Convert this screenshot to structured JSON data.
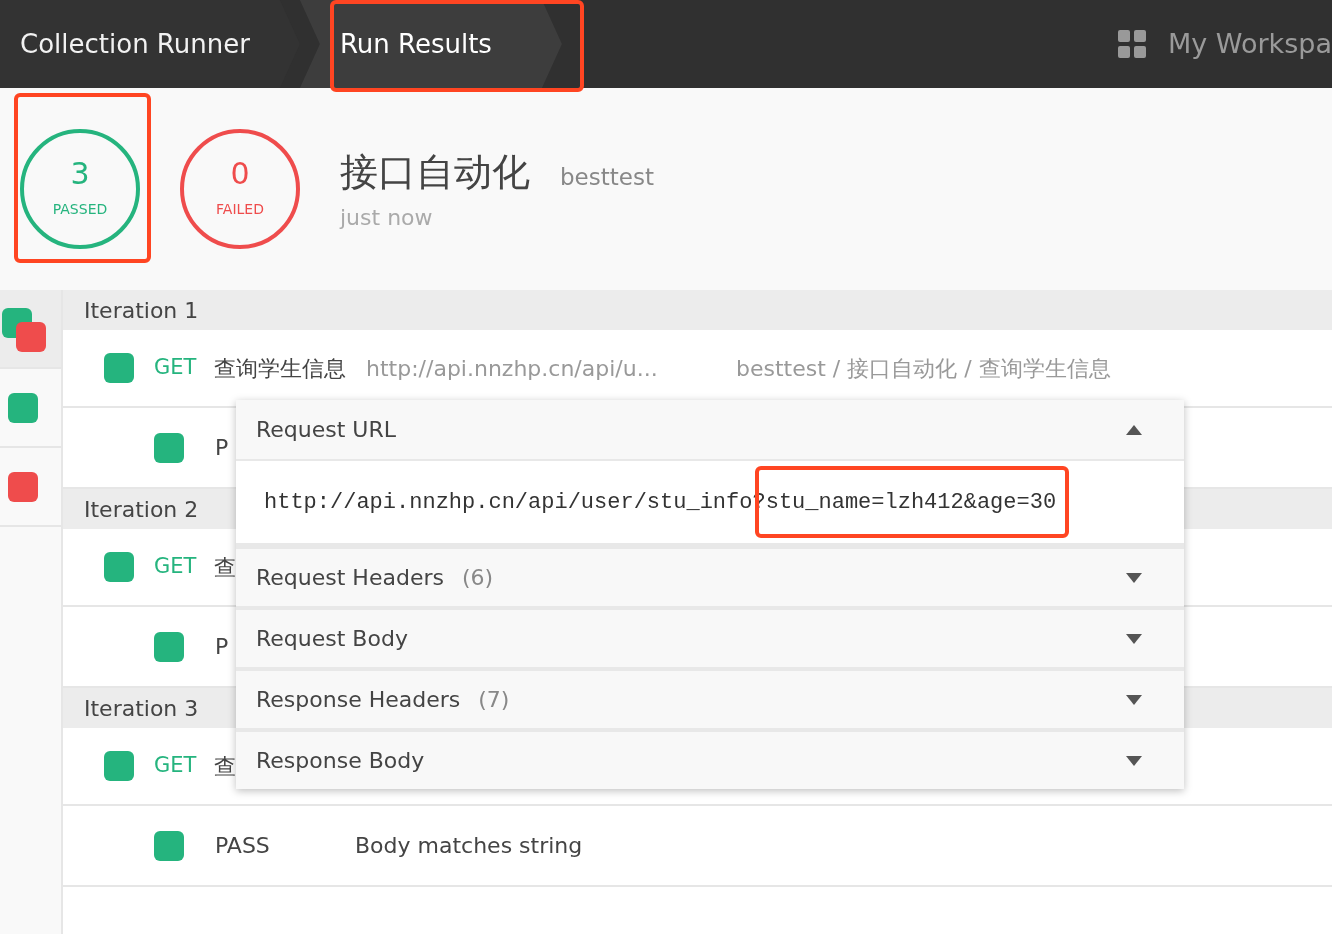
{
  "header": {
    "tabs": [
      {
        "label": "Collection Runner",
        "selected": false
      },
      {
        "label": "Run Results",
        "selected": true
      }
    ],
    "workspace": "My Workspa"
  },
  "summary": {
    "counts": [
      {
        "kind": "passed",
        "count": "3",
        "label": "PASSED"
      },
      {
        "kind": "failed",
        "count": "0",
        "label": "FAILED"
      }
    ],
    "collection": "接口自动化",
    "environment": "besttest",
    "time": "just now"
  },
  "sidebar": [
    {
      "selected": true,
      "markers": [
        {
          "color": "#25b47e"
        },
        {
          "color": "#ef4c4c"
        }
      ]
    },
    {
      "selected": false,
      "markers": [
        {
          "color": "#25b47e"
        }
      ]
    },
    {
      "selected": false,
      "markers": [
        {
          "color": "#ef4c4c"
        }
      ]
    }
  ],
  "iterations": [
    {
      "title": "Iteration 1",
      "rows": [
        {
          "kind": "request",
          "color": "#25b47e",
          "method": "GET",
          "name": "查询学生信息",
          "url": "http://api.nnzhp.cn/api/u...",
          "path": "besttest / 接口自动化 / 查询学生信息"
        },
        {
          "kind": "test",
          "color": "#25b47e",
          "result": "P"
        }
      ]
    },
    {
      "title": "Iteration 2",
      "rows": [
        {
          "kind": "request",
          "color": "#25b47e",
          "method": "GET",
          "name": "查"
        },
        {
          "kind": "test",
          "color": "#25b47e",
          "result": "P"
        }
      ]
    },
    {
      "title": "Iteration 3",
      "rows": [
        {
          "kind": "request",
          "color": "#25b47e",
          "method": "GET",
          "name": "查"
        },
        {
          "kind": "test",
          "color": "#25b47e",
          "result": "PASS",
          "name": "Body matches string"
        }
      ]
    }
  ],
  "popup": {
    "sections": [
      {
        "title": "Request URL",
        "expanded": true,
        "value": "http://api.nnzhp.cn/api/user/stu_info?stu_name=lzh412&age=30"
      },
      {
        "title": "Request Headers",
        "count": "(6)",
        "expanded": false
      },
      {
        "title": "Request Body",
        "expanded": false
      },
      {
        "title": "Response Headers",
        "count": "(7)",
        "expanded": false
      },
      {
        "title": "Response Body",
        "expanded": false
      }
    ]
  }
}
